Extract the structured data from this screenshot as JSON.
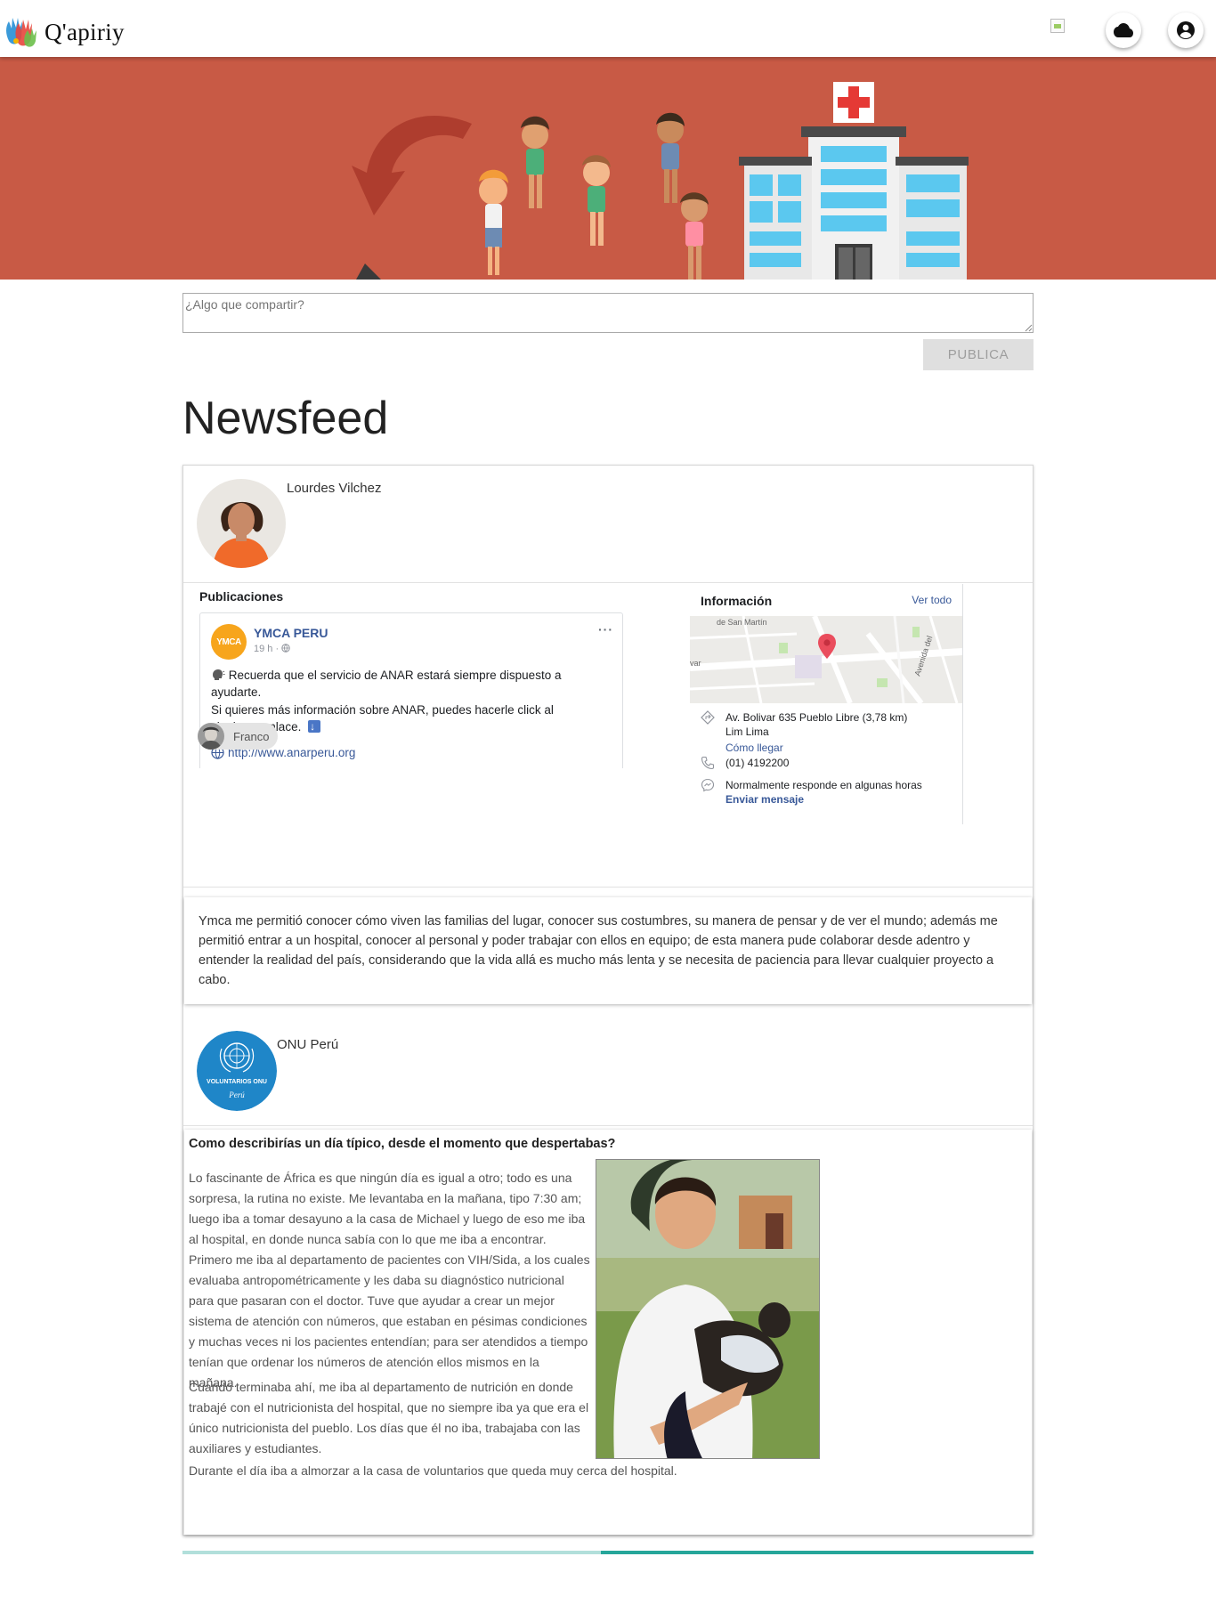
{
  "app": {
    "name": "Q'apiriy"
  },
  "share": {
    "placeholder": "¿Algo que compartir?",
    "publish_label": "PUBLICA"
  },
  "feed": {
    "title": "Newsfeed"
  },
  "post1": {
    "author": "Lourdes Vilchez",
    "fb": {
      "section_title": "Publicaciones",
      "page_name": "YMCA PERU",
      "logo_text": "YMCA",
      "time": "19 h ·",
      "menu": "···",
      "line1": "Recuerda que el servicio de ANAR estará siempre dispuesto a ayudarte.",
      "line2": "Si quieres más información sobre ANAR, puedes hacerle click al siguiente enlace.",
      "link": "http://www.anarperu.org",
      "info_title": "Información",
      "info_link": "Ver todo",
      "address": "Av. Bolivar 635 Pueblo Libre (3,78 km)",
      "city": "Lim Lima",
      "directions": "Cómo llegar",
      "phone": "(01) 4192200",
      "response": "Normalmente responde en algunas horas",
      "send_message": "Enviar mensaje",
      "map_label_1": "de San Martín",
      "map_label_2": "var",
      "map_label_3": "Avenida del"
    },
    "tag": {
      "label": "Franco"
    },
    "comment": "Ymca me permitió conocer cómo viven las familias del lugar, conocer sus costumbres, su manera de pensar y de ver el mundo; además me permitió entrar a un hospital, conocer al personal y poder trabajar con ellos en equipo; de esta manera pude colaborar desde adentro y entender la realidad del país, considerando que la vida allá es mucho más lenta y se necesita de paciencia para llevar cualquier proyecto a cabo."
  },
  "post2": {
    "author": "ONU Perú",
    "logo_line1": "VOLUNTARIOS ONU",
    "logo_line2": "Perú",
    "question": "Como describirías un día típico, desde el momento que despertabas?",
    "para1": "Lo fascinante de África es que ningún día es igual a otro; todo es una sorpresa, la rutina no existe. Me levantaba en la mañana, tipo 7:30 am; luego iba a tomar desayuno a la casa de Michael y luego de eso me iba al hospital, en donde nunca sabía con lo que me iba a encontrar. Primero me iba al departamento de pacientes con VIH/Sida, a los cuales evaluaba antropométricamente y les daba su diagnóstico nutricional para que pasaran con el doctor. Tuve que ayudar a crear un mejor sistema de atención con números, que estaban en pésimas condiciones y muchas veces ni los pacientes entendían; para ser atendidos a tiempo tenían que ordenar los números de atención ellos mismos en la mañana.",
    "para2": "Cuando terminaba ahí, me iba al departamento de nutrición en donde trabajé con el nutricionista del hospital, que no siempre iba ya que era el único nutricionista del pueblo. Los días que él no iba, trabajaba con las auxiliares y estudiantes.",
    "para3": "Durante el día iba a almorzar a la casa de voluntarios que queda muy cerca del hospital."
  },
  "scroll_progress": 0.5,
  "colors": {
    "hero": "#c85a45",
    "accent": "#26a69a",
    "fb_blue": "#385898"
  }
}
